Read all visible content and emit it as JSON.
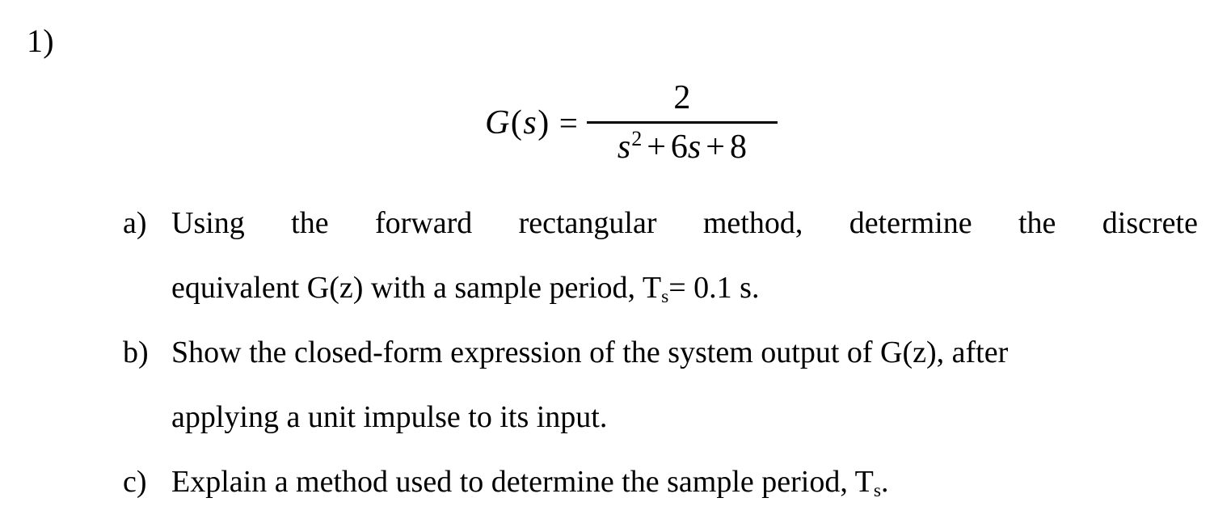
{
  "document": {
    "background_color": "#ffffff",
    "text_color": "#000000",
    "question_number": "1)"
  },
  "equation": {
    "lhs_function": "G",
    "lhs_open_paren": "(",
    "lhs_variable": "s",
    "lhs_close_paren": ")",
    "equals": "=",
    "numerator": "2",
    "denominator": {
      "term1_variable": "s",
      "term1_exponent": "2",
      "operator1": "+",
      "term2_coefficient": "6",
      "term2_variable": "s",
      "operator2": "+",
      "term3_constant": "8"
    },
    "plain_text": "G(s) = 2 / (s^2 + 6s + 8)"
  },
  "list": {
    "items": [
      {
        "marker": "a)",
        "lines": [
          {
            "justified": true,
            "words": [
              "Using",
              "the",
              "forward",
              "rectangular",
              "method,",
              "determine",
              "the",
              "discrete"
            ]
          },
          {
            "justified": false,
            "prefix": "equivalent G(z) with a sample period, T",
            "subscript": "s",
            "suffix": "= 0.1 s."
          }
        ],
        "plain_text": "Using the forward rectangular method, determine the discrete equivalent G(z) with a sample period, Ts= 0.1 s."
      },
      {
        "marker": "b)",
        "lines": [
          {
            "justified": false,
            "prefix": "Show the closed-form expression of the system output of G(z), after",
            "subscript": "",
            "suffix": ""
          },
          {
            "justified": false,
            "prefix": "applying a unit impulse to its input.",
            "subscript": "",
            "suffix": ""
          }
        ],
        "plain_text": "Show the closed-form expression of the system output of G(z), after applying a unit impulse to its input."
      },
      {
        "marker": "c)",
        "lines": [
          {
            "justified": false,
            "prefix": "Explain a method used to determine the sample period, T",
            "subscript": "s",
            "suffix": "."
          }
        ],
        "plain_text": "Explain a method used to determine the sample period, Ts."
      }
    ]
  }
}
